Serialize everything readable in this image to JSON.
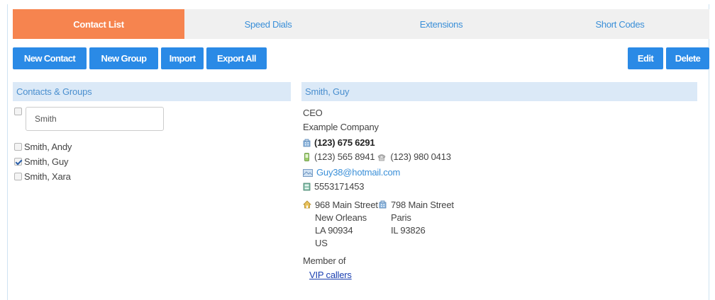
{
  "tabs": [
    "Contact List",
    "Speed Dials",
    "Extensions",
    "Short Codes"
  ],
  "toolbar_left": [
    "New Contact",
    "New Group",
    "Import",
    "Export All"
  ],
  "toolbar_right": [
    "Edit",
    "Delete"
  ],
  "left_panel": {
    "title": "Contacts & Groups",
    "search_value": "Smith",
    "contacts": [
      {
        "name": "Smith, Andy",
        "checked": false
      },
      {
        "name": "Smith, Guy",
        "checked": true
      },
      {
        "name": "Smith, Xara",
        "checked": false
      }
    ]
  },
  "detail": {
    "title": "Smith, Guy",
    "job_title": "CEO",
    "company": "Example Company",
    "work_phone": "(123) 675 6291",
    "mobile_phone": "(123) 565 8941",
    "home_phone": "(123) 980 0413",
    "email": "Guy38@hotmail.com",
    "other_number": "5553171453",
    "home_address": {
      "street": "968 Main Street",
      "city": "New Orleans",
      "state_zip": "LA 90934",
      "country": "US"
    },
    "work_address": {
      "street": "798 Main Street",
      "city": "Paris",
      "state_zip": "IL 93826"
    },
    "member_of_label": "Member of",
    "groups": [
      "VIP callers"
    ]
  },
  "colors": {
    "accent_orange": "#f6844f",
    "button_blue": "#2a8ae6",
    "header_bg": "#dbe9f7",
    "link_blue": "#3a8fd8"
  }
}
